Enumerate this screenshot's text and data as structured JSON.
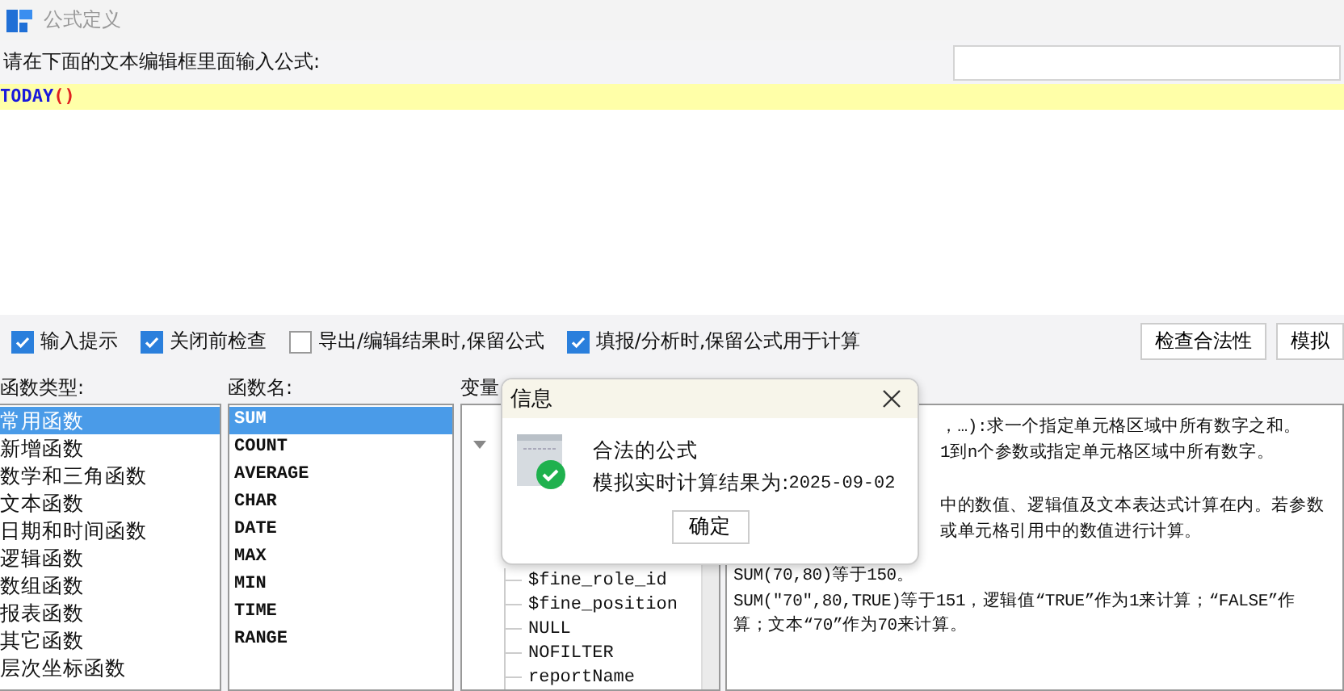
{
  "window": {
    "title": "公式定义"
  },
  "editor": {
    "prompt": "请在下面的文本编辑框里面输入公式:",
    "tokens": [
      {
        "text": "TODAY",
        "kind": "function"
      },
      {
        "text": "()",
        "kind": "paren"
      }
    ]
  },
  "options": [
    {
      "label": "输入提示",
      "checked": true
    },
    {
      "label": "关闭前检查",
      "checked": true
    },
    {
      "label": "导出/编辑结果时,保留公式",
      "checked": false
    },
    {
      "label": "填报/分析时,保留公式用于计算",
      "checked": true
    }
  ],
  "buttons": [
    "检查合法性",
    "模拟"
  ],
  "function_types": {
    "label": "函数类型:",
    "items": [
      {
        "label": "常用函数",
        "selected": true
      },
      {
        "label": "新增函数",
        "selected": false
      },
      {
        "label": "数学和三角函数",
        "selected": false
      },
      {
        "label": "文本函数",
        "selected": false
      },
      {
        "label": "日期和时间函数",
        "selected": false
      },
      {
        "label": "逻辑函数",
        "selected": false
      },
      {
        "label": "数组函数",
        "selected": false
      },
      {
        "label": "报表函数",
        "selected": false
      },
      {
        "label": "其它函数",
        "selected": false
      },
      {
        "label": "层次坐标函数",
        "selected": false
      }
    ]
  },
  "function_names": {
    "label": "函数名:",
    "items": [
      {
        "label": "SUM",
        "selected": true
      },
      {
        "label": "COUNT",
        "selected": false
      },
      {
        "label": "AVERAGE",
        "selected": false
      },
      {
        "label": "CHAR",
        "selected": false
      },
      {
        "label": "DATE",
        "selected": false
      },
      {
        "label": "MAX",
        "selected": false
      },
      {
        "label": "MIN",
        "selected": false
      },
      {
        "label": "TIME",
        "selected": false
      },
      {
        "label": "RANGE",
        "selected": false
      }
    ]
  },
  "variables": {
    "label": "变量",
    "expanded": true,
    "items": [
      "$fine_role_id",
      "$fine_position",
      "NULL",
      "NOFILTER",
      "reportName"
    ]
  },
  "description": {
    "paragraphs": [
      {
        "lines": [
          {
            "text": "，…):求一个指定单元格区域中所有数字之和。",
            "kind": "clipped"
          },
          {
            "text": "1到n个参数或指定单元格区域中所有数字。",
            "kind": "clipped"
          }
        ]
      },
      {
        "lines": [
          {
            "text": "中的数值、逻辑值及文本表达式计算在内。若参数",
            "kind": "clipped"
          },
          {
            "text": "或单元格引用中的数值进行计算。",
            "kind": "clipped"
          }
        ]
      },
      {
        "lines": [
          {
            "text": "SUM(70,80)等于150。",
            "kind": "full"
          },
          {
            "text": "SUM(\"70\",80,TRUE)等于151，逻辑值“TRUE”作为1来计算；“FALSE”作",
            "kind": "full"
          },
          {
            "text": "算；文本“70”作为70来计算。",
            "kind": "full"
          }
        ]
      }
    ]
  },
  "dialog": {
    "title": "信息",
    "message": "合法的公式",
    "result_label": "模拟实时计算结果为:",
    "result": "2025-09-02",
    "ok": "确定"
  }
}
